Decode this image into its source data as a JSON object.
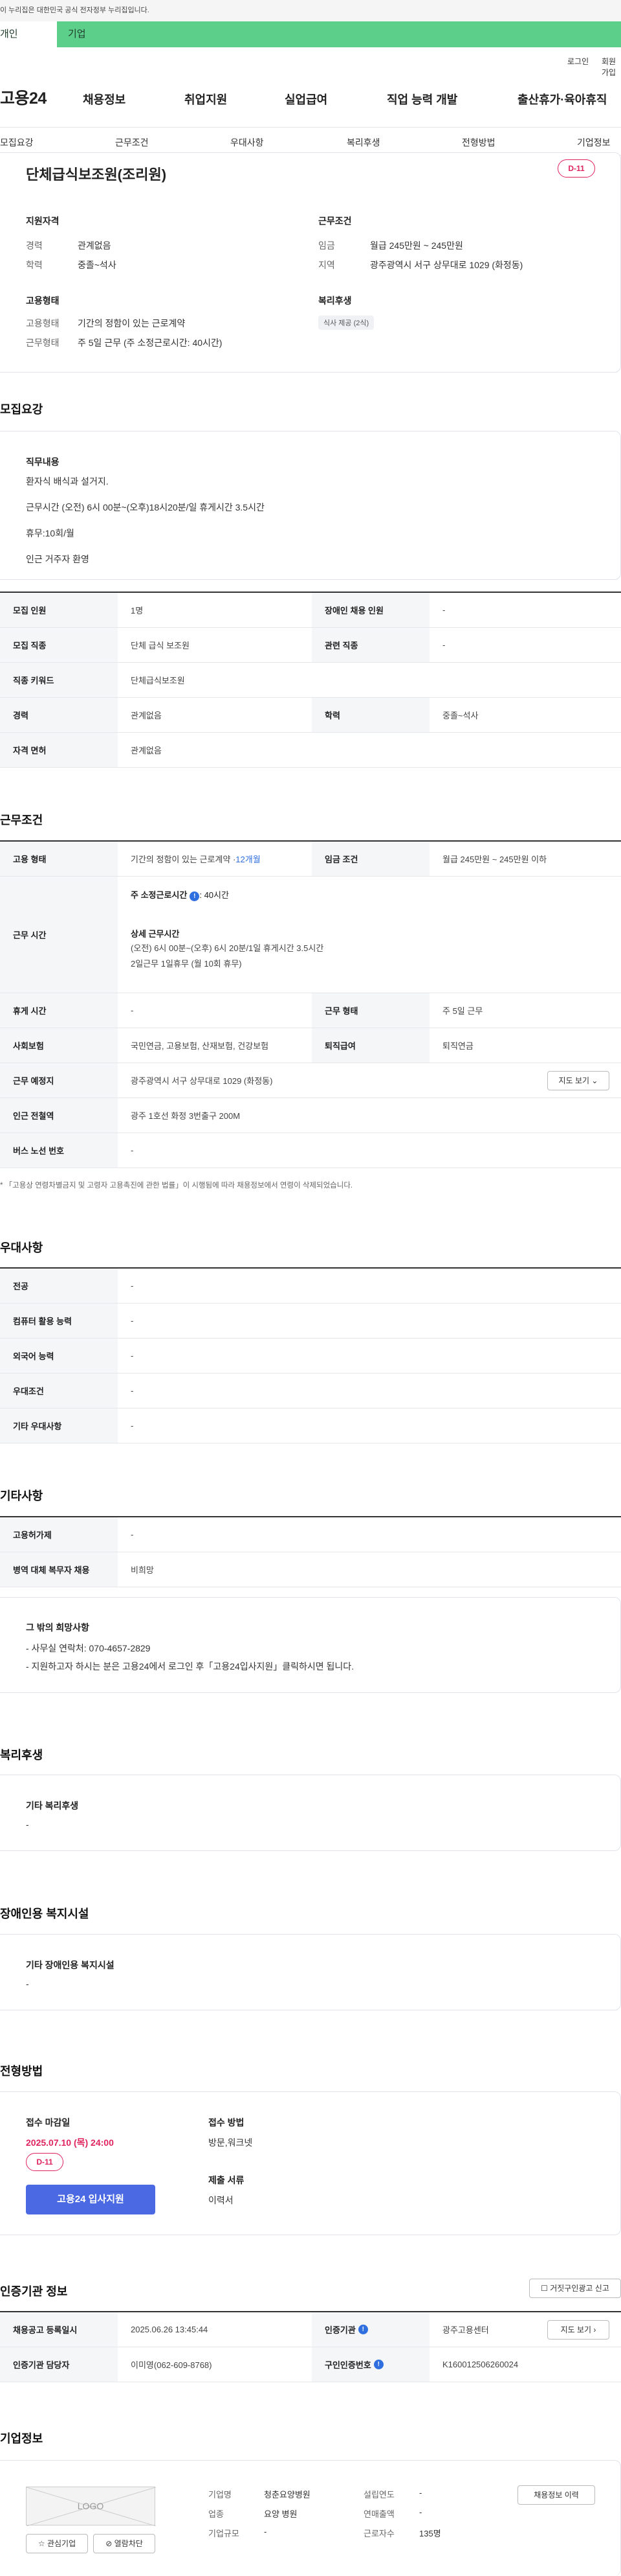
{
  "gov_banner": "이 누리집은 대한민국 공식 전자정부 누리집입니다.",
  "audience_tabs": [
    "개인",
    "기업"
  ],
  "util": {
    "login": "로그인",
    "join": "회원가입"
  },
  "site_logo": "고용24",
  "gnb": [
    "채용정보",
    "취업지원",
    "실업급여",
    "직업 능력 개발",
    "출산휴가·육아휴직"
  ],
  "subnav": [
    "모집요강",
    "근무조건",
    "우대사항",
    "복리후생",
    "전형방법",
    "기업정보"
  ],
  "summary": {
    "title": "단체급식보조원(조리원)",
    "dday": "D-11",
    "qual_head": "지원자격",
    "career_label": "경력",
    "career_value": "관계없음",
    "edu_label": "학력",
    "edu_value": "중졸~석사",
    "cond_head": "근무조건",
    "wage_label": "임금",
    "wage_value": "월급 245만원 ~ 245만원",
    "region_label": "지역",
    "region_value": "광주광역시 서구 상무대로 1029 (화정동)",
    "emp_head": "고용형태",
    "emptype_label": "고용형태",
    "emptype_value": "기간의 정함이 있는 근로계약",
    "worktype_label": "근무형태",
    "worktype_value": "주 5일 근무 (주 소정근로시간: 40시간)",
    "welfare_head": "복리후생",
    "welfare_pill": "식사 제공 (2식)"
  },
  "recruit": {
    "heading": "모집요강",
    "duty_head": "직무내용",
    "duty_lines": [
      "환자식 배식과 설거지.",
      "근무시간 (오전) 6시 00분~(오후)18시20분/일 휴게시간 3.5시간",
      "휴무:10회/월",
      "인근 거주자 환영"
    ],
    "rows": [
      {
        "th1": "모집 인원",
        "td1": "1명",
        "th2": "장애인 채용 인원",
        "td2": "-"
      },
      {
        "th1": "모집 직종",
        "td1": "단체 급식 보조원",
        "th2": "관련 직종",
        "td2": "-"
      },
      {
        "th1": "직종 키워드",
        "td1": "단체급식보조원"
      },
      {
        "th1": "경력",
        "td1": "관계없음",
        "th2": "학력",
        "td2": "중졸~석사"
      },
      {
        "th1": "자격 면허",
        "td1": "관계없음"
      }
    ]
  },
  "conditions": {
    "heading": "근무조건",
    "emptype_th": "고용 형태",
    "emptype_td": "기간의 정함이 있는 근로계약 · ",
    "emptype_period": "12개월",
    "wage_th": "임금 조건",
    "wage_td": "월급 245만원 ~ 245만원 이하",
    "hours_th": "근무 시간",
    "hours_line1": "주 소정근로시간",
    "hours_line1b": ": 40시간",
    "hours_line2": "상세 근무시간",
    "hours_line3": "(오전) 6시 00분~(오후) 6시 20분/1일 휴게시간 3.5시간",
    "hours_line4": "2일근무 1일휴무 (월 10회 휴무)",
    "break_th": "휴게 시간",
    "break_td": "-",
    "worktype_th": "근무 형태",
    "worktype_td": "주 5일 근무",
    "ins_th": "사회보험",
    "ins_td": "국민연금, 고용보험, 산재보험, 건강보험",
    "retire_th": "퇴직급여",
    "retire_td": "퇴직연금",
    "place_th": "근무 예정지",
    "place_td": "광주광역시 서구 상무대로 1029 (화정동)",
    "map_btn": "지도 보기",
    "subway_th": "인근 전철역",
    "subway_td": "광주 1호선 화정 3번출구 200M",
    "bus_th": "버스 노선 번호",
    "bus_td": "-",
    "note": "* 「고용상 연령차별금지 및 고령자 고용촉진에 관한 법률」이 시행됨에 따라 채용정보에서 연령이 삭제되었습니다."
  },
  "prefs": {
    "heading": "우대사항",
    "rows": [
      {
        "th": "전공",
        "td": "-"
      },
      {
        "th": "컴퓨터 활용 능력",
        "td": "-"
      },
      {
        "th": "외국어 능력",
        "td": "-"
      },
      {
        "th": "우대조건",
        "td": "-"
      },
      {
        "th": "기타 우대사항",
        "td": "-"
      }
    ]
  },
  "etc": {
    "heading": "기타사항",
    "rows": [
      {
        "th": "고용허가제",
        "td": "-"
      },
      {
        "th": "병역 대체 복무자 채용",
        "td": "비희망"
      }
    ],
    "box_head": "그 밖의 희망사항",
    "box_lines": [
      "- 사무실 연락처: 070-4657-2829",
      "- 지원하고자 하시는 분은 고용24에서 로그인 후「고용24입사지원」클릭하시면 됩니다."
    ]
  },
  "welfare": {
    "heading": "복리후생",
    "box_head": "기타 복리후생",
    "box_value": "-"
  },
  "disability": {
    "heading": "장애인용 복지시설",
    "box_head": "기타 장애인용 복지시설",
    "box_value": "-"
  },
  "selection": {
    "heading": "전형방법",
    "deadline_head": "접수 마감일",
    "deadline_value": "2025.07.10 (목) 24:00",
    "dday": "D-11",
    "apply_btn": "고용24 입사지원",
    "method_head": "접수 방법",
    "method_value": "방문,워크넷",
    "docs_head": "제출 서류",
    "docs_value": "이력서"
  },
  "cert": {
    "heading": "인증기관 정보",
    "report_btn": "거짓구인광고 신고",
    "reg_th": "채용공고 등록일시",
    "reg_td": "2025.06.26 13:45:44",
    "org_th": "인증기관",
    "org_td": "광주고용센터",
    "map_btn": "지도 보기",
    "mgr_th": "인증기관 담당자",
    "mgr_td": "이미영(062-609-8768)",
    "no_th": "구인인증번호",
    "no_td": "K160012506260024"
  },
  "company": {
    "heading": "기업정보",
    "logo_text": "LOGO",
    "btn_interest": "관심기업",
    "btn_block": "열람차단",
    "name_label": "기업명",
    "name_value": "청춘요양병원",
    "founded_label": "설립연도",
    "founded_value": "-",
    "industry_label": "업종",
    "industry_value": "요양 병원",
    "sales_label": "연매출액",
    "sales_value": "-",
    "size_label": "기업규모",
    "size_value": "-",
    "staff_label": "근로자수",
    "staff_value": "135명",
    "history_btn": "채용정보 이력"
  }
}
